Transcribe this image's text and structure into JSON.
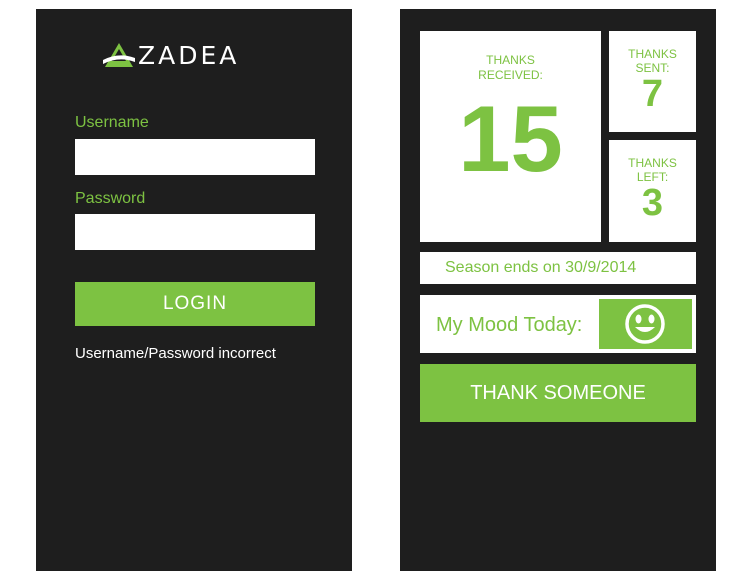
{
  "login": {
    "logo_text": "ZADEA",
    "username_label": "Username",
    "username_value": "",
    "password_label": "Password",
    "password_value": "",
    "login_button": "LOGIN",
    "error_message": "Username/Password incorrect"
  },
  "dashboard": {
    "thanks_received_label": "THANKS RECEIVED:",
    "thanks_received_value": "15",
    "thanks_sent_label": "THANKS SENT:",
    "thanks_sent_value": "7",
    "thanks_left_label": "THANKS LEFT:",
    "thanks_left_value": "3",
    "season_text": "Season ends on 30/9/2014",
    "mood_label": "My Mood Today:",
    "mood_icon": "smiley-face-icon",
    "thank_button": "THANK SOMEONE"
  },
  "colors": {
    "accent": "#7dc242",
    "background": "#1e1e1e",
    "surface": "#ffffff"
  }
}
